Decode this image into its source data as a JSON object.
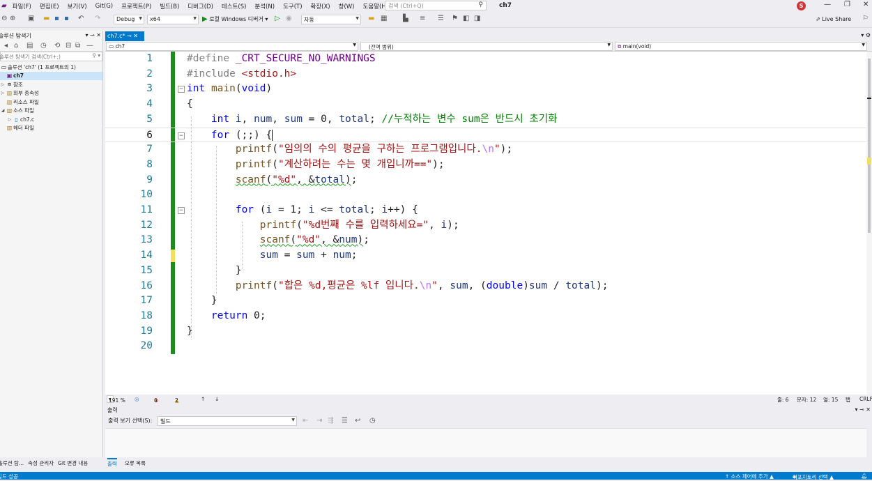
{
  "menu": [
    "파일(F)",
    "편집(E)",
    "보기(V)",
    "Git(G)",
    "프로젝트(P)",
    "빌드(B)",
    "디버그(D)",
    "테스트(S)",
    "분석(N)",
    "도구(T)",
    "확장(X)",
    "창(W)",
    "도움말(H)"
  ],
  "search": {
    "placeholder": "검색 (Ctrl+Q)"
  },
  "solution_name": "ch7",
  "user_initial": "S",
  "toolbar": {
    "config": "Debug",
    "platform": "x64",
    "run_label": "로컬 Windows 디버거",
    "auto": "자동",
    "live_share": "Live Share"
  },
  "solution_explorer": {
    "title": "솔루션 탐색기",
    "search_placeholder": "솔루션 탐색기 검색(Ctrl+;)",
    "items": [
      {
        "label": "솔루션 'ch7' (1 프로젝트의 1)"
      },
      {
        "label": "ch7"
      },
      {
        "label": "참조"
      },
      {
        "label": "외부 종속성"
      },
      {
        "label": "리소스 파일"
      },
      {
        "label": "소스 파일"
      },
      {
        "label": "ch7.c"
      },
      {
        "label": "헤더 파일"
      }
    ],
    "tabs": [
      "솔루션 탐...",
      "속성 관리자",
      "Git 변경 내용"
    ]
  },
  "editor": {
    "tab_label": "ch7.c*",
    "nav_project": "ch7",
    "nav_scope": "(전역 범위)",
    "nav_member": "main(void)",
    "line_numbers": [
      "1",
      "2",
      "3",
      "4",
      "5",
      "6",
      "7",
      "8",
      "9",
      "10",
      "11",
      "12",
      "13",
      "14",
      "15",
      "16",
      "17",
      "18",
      "19",
      "20"
    ],
    "zoom": "191 %",
    "errors": "0",
    "warnings": "2",
    "cursor_line": "줄: 6",
    "cursor_char": "문자: 12",
    "cursor_col": "열: 15",
    "tab_mode": "탭",
    "line_ending": "CRLF"
  },
  "output": {
    "title": "출력",
    "source_label": "출력 보기 선택(S):",
    "source_value": "빌드"
  },
  "bottom_tabs": [
    "출력",
    "오류 목록"
  ],
  "status": {
    "left": "빌드 성공",
    "source_control": "↑ 소스 제어에 추가 ▲",
    "repo": "리포지토리 선택 ▲"
  },
  "colors": {
    "accent": "#007acc",
    "gutter_green": "#1d8c1d"
  }
}
